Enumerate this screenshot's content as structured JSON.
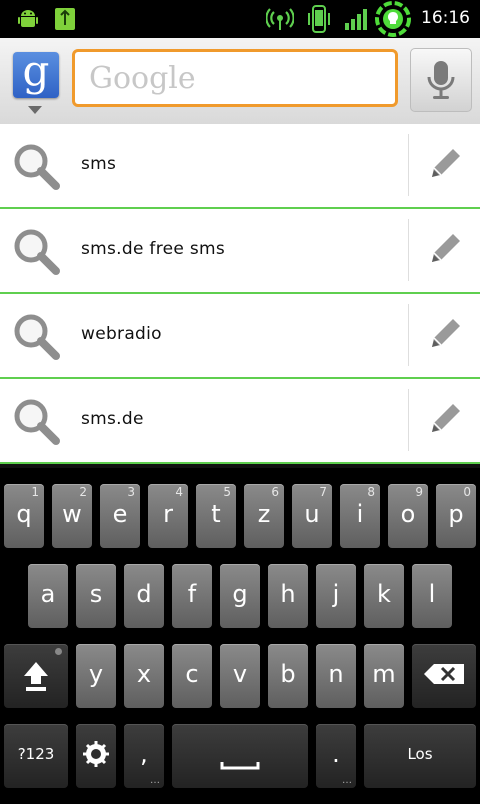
{
  "status_bar": {
    "time": "16:16",
    "icons": [
      "android-icon",
      "usb-debug-icon",
      "wifi-hotspot-icon",
      "phone-vibrate-icon",
      "signal-bars-icon",
      "battery-icon"
    ]
  },
  "search": {
    "placeholder": "Google",
    "logo_letter": "g",
    "colors": {
      "accent": "#f09a2c",
      "logo": "#3a6fd0",
      "divider": "#5fcf4f"
    }
  },
  "suggestions": [
    {
      "text": "sms"
    },
    {
      "text": "sms.de free sms"
    },
    {
      "text": "webradio"
    },
    {
      "text": "sms.de"
    }
  ],
  "keyboard": {
    "row1": [
      {
        "ch": "q",
        "num": "1"
      },
      {
        "ch": "w",
        "num": "2"
      },
      {
        "ch": "e",
        "num": "3"
      },
      {
        "ch": "r",
        "num": "4"
      },
      {
        "ch": "t",
        "num": "5"
      },
      {
        "ch": "z",
        "num": "6"
      },
      {
        "ch": "u",
        "num": "7"
      },
      {
        "ch": "i",
        "num": "8"
      },
      {
        "ch": "o",
        "num": "9"
      },
      {
        "ch": "p",
        "num": "0"
      }
    ],
    "row2": [
      "a",
      "s",
      "d",
      "f",
      "g",
      "h",
      "j",
      "k",
      "l"
    ],
    "row3": [
      "y",
      "x",
      "c",
      "v",
      "b",
      "n",
      "m"
    ],
    "symbols_label": "?123",
    "comma_label": ",",
    "period_label": ".",
    "enter_label": "Los"
  }
}
